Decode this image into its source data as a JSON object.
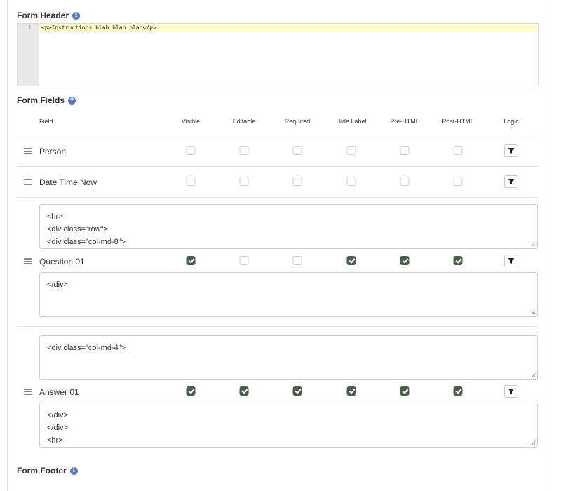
{
  "form_header": {
    "label": "Form Header",
    "editor": {
      "line_number": "1",
      "code": "<p>Instructions blah blah blah</p>"
    }
  },
  "form_fields": {
    "label": "Form Fields",
    "columns": [
      "Field",
      "Visible",
      "Editable",
      "Required",
      "Hide Label",
      "Pre-HTML",
      "Post-HTML",
      "Logic"
    ],
    "rows": [
      {
        "name": "Person",
        "visible": false,
        "editable": false,
        "required": false,
        "hide_label": false,
        "pre_html": false,
        "post_html": false
      },
      {
        "name": "Date Time Now",
        "visible": false,
        "editable": false,
        "required": false,
        "hide_label": false,
        "pre_html": false,
        "post_html": false
      },
      {
        "name": "Question 01",
        "visible": true,
        "editable": false,
        "required": false,
        "hide_label": true,
        "pre_html": true,
        "post_html": true,
        "pre_html_lines": [
          "<hr>",
          "<div class=\"row\">",
          "<div class=\"col-md-8\">"
        ],
        "post_html_lines": [
          "</div>"
        ]
      },
      {
        "name": "Answer 01",
        "visible": true,
        "editable": true,
        "required": true,
        "hide_label": true,
        "pre_html": true,
        "post_html": true,
        "pre_html_lines": [
          "<div class=\"col-md-4\">"
        ],
        "post_html_lines": [
          "</div>",
          "</div>",
          "<hr>"
        ]
      }
    ]
  },
  "form_footer": {
    "label": "Form Footer"
  },
  "colors": {
    "checked": "#4b5e4b",
    "info_icon": "#5b7dbf",
    "editor_highlight": "#ffffcc"
  },
  "icons": {
    "info": "info-icon",
    "help": "question-icon",
    "drag": "drag-handle-icon",
    "logic": "filter-icon"
  }
}
